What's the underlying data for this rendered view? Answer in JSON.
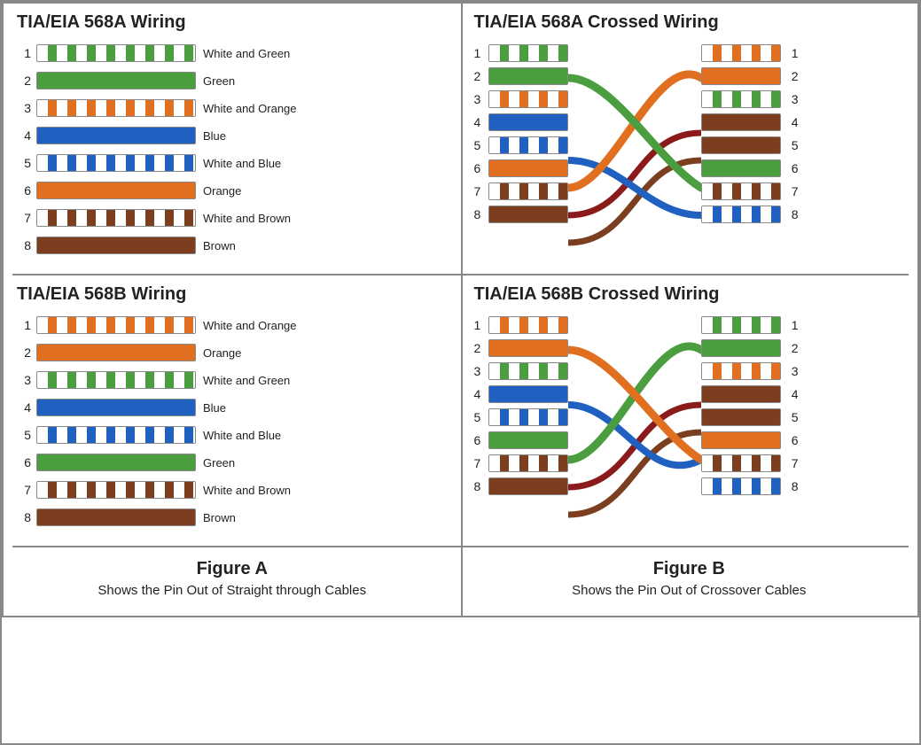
{
  "sections": {
    "tia568a_straight": {
      "title": "TIA/EIA 568A Wiring",
      "pins": [
        {
          "num": "1",
          "style": "stripe-white-green",
          "label": "White and Green"
        },
        {
          "num": "2",
          "style": "solid-green",
          "label": "Green"
        },
        {
          "num": "3",
          "style": "stripe-white-orange",
          "label": "White and Orange"
        },
        {
          "num": "4",
          "style": "solid-blue",
          "label": "Blue"
        },
        {
          "num": "5",
          "style": "stripe-white-blue",
          "label": "White and Blue"
        },
        {
          "num": "6",
          "style": "solid-orange",
          "label": "Orange"
        },
        {
          "num": "7",
          "style": "stripe-white-brown",
          "label": "White and Brown"
        },
        {
          "num": "8",
          "style": "solid-brown",
          "label": "Brown"
        }
      ]
    },
    "tia568b_straight": {
      "title": "TIA/EIA 568B Wiring",
      "pins": [
        {
          "num": "1",
          "style": "stripe-white-orange",
          "label": "White and Orange"
        },
        {
          "num": "2",
          "style": "solid-orange",
          "label": "Orange"
        },
        {
          "num": "3",
          "style": "stripe-white-green",
          "label": "White and Green"
        },
        {
          "num": "4",
          "style": "solid-blue",
          "label": "Blue"
        },
        {
          "num": "5",
          "style": "stripe-white-blue",
          "label": "White and Blue"
        },
        {
          "num": "6",
          "style": "solid-green",
          "label": "Green"
        },
        {
          "num": "7",
          "style": "stripe-white-brown",
          "label": "White and Brown"
        },
        {
          "num": "8",
          "style": "solid-brown",
          "label": "Brown"
        }
      ]
    },
    "tia568a_crossed": {
      "title": "TIA/EIA 568A Crossed Wiring",
      "left": [
        {
          "num": "1",
          "style": "stripe-white-green"
        },
        {
          "num": "2",
          "style": "solid-green"
        },
        {
          "num": "3",
          "style": "stripe-white-orange"
        },
        {
          "num": "4",
          "style": "solid-blue"
        },
        {
          "num": "5",
          "style": "stripe-white-blue"
        },
        {
          "num": "6",
          "style": "solid-orange"
        },
        {
          "num": "7",
          "style": "stripe-white-brown"
        },
        {
          "num": "8",
          "style": "solid-brown"
        }
      ],
      "right": [
        {
          "num": "1",
          "style": "stripe-white-orange"
        },
        {
          "num": "2",
          "style": "solid-orange"
        },
        {
          "num": "3",
          "style": "stripe-white-green"
        },
        {
          "num": "4",
          "style": "solid-brown"
        },
        {
          "num": "5",
          "style": "solid-brown"
        },
        {
          "num": "6",
          "style": "solid-green"
        },
        {
          "num": "7",
          "style": "stripe-white-brown"
        },
        {
          "num": "8",
          "style": "stripe-white-blue"
        }
      ]
    },
    "tia568b_crossed": {
      "title": "TIA/EIA 568B Crossed Wiring",
      "left": [
        {
          "num": "1",
          "style": "stripe-white-orange"
        },
        {
          "num": "2",
          "style": "solid-orange"
        },
        {
          "num": "3",
          "style": "stripe-white-green"
        },
        {
          "num": "4",
          "style": "solid-blue"
        },
        {
          "num": "5",
          "style": "stripe-white-blue"
        },
        {
          "num": "6",
          "style": "solid-green"
        },
        {
          "num": "7",
          "style": "stripe-white-brown"
        },
        {
          "num": "8",
          "style": "solid-brown"
        }
      ],
      "right": [
        {
          "num": "1",
          "style": "stripe-white-green"
        },
        {
          "num": "2",
          "style": "solid-green"
        },
        {
          "num": "3",
          "style": "stripe-white-orange"
        },
        {
          "num": "4",
          "style": "solid-brown"
        },
        {
          "num": "5",
          "style": "solid-brown"
        },
        {
          "num": "6",
          "style": "solid-orange"
        },
        {
          "num": "7",
          "style": "stripe-white-brown"
        },
        {
          "num": "8",
          "style": "stripe-white-blue"
        }
      ]
    }
  },
  "figures": {
    "a": {
      "label": "Figure A",
      "desc": "Shows the Pin Out of Straight through Cables"
    },
    "b": {
      "label": "Figure B",
      "desc": "Shows the Pin Out of Crossover Cables"
    }
  }
}
